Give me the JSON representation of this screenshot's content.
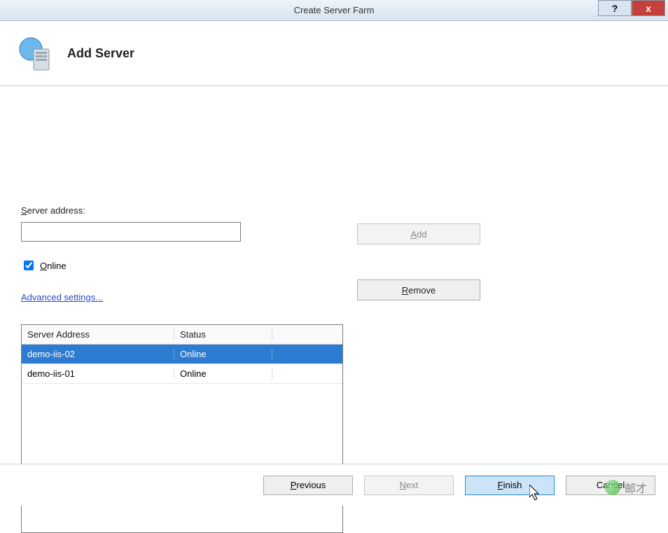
{
  "titlebar": {
    "title": "Create Server Farm",
    "help_symbol": "?",
    "close_symbol": "x"
  },
  "header": {
    "title": "Add Server"
  },
  "form": {
    "server_address_label_pre": "S",
    "server_address_label_rest": "erver address:",
    "server_address_value": "",
    "online_label_pre": "O",
    "online_label_rest": "nline",
    "online_checked": true,
    "advanced_label": "Advanced settings..."
  },
  "buttons": {
    "add_pre": "A",
    "add_rest": "dd",
    "add_disabled": true,
    "remove_pre": "R",
    "remove_rest": "emove"
  },
  "table": {
    "headers": {
      "address": "Server Address",
      "status": "Status"
    },
    "rows": [
      {
        "address": "demo-iis-02",
        "status": "Online",
        "selected": true
      },
      {
        "address": "demo-iis-01",
        "status": "Online",
        "selected": false
      }
    ]
  },
  "footer": {
    "previous_pre": "P",
    "previous_rest": "revious",
    "next_pre": "N",
    "next_rest": "ext",
    "next_disabled": true,
    "finish_pre": "F",
    "finish_rest": "inish",
    "cancel": "Cancel"
  },
  "watermark": {
    "text": "邮才"
  }
}
